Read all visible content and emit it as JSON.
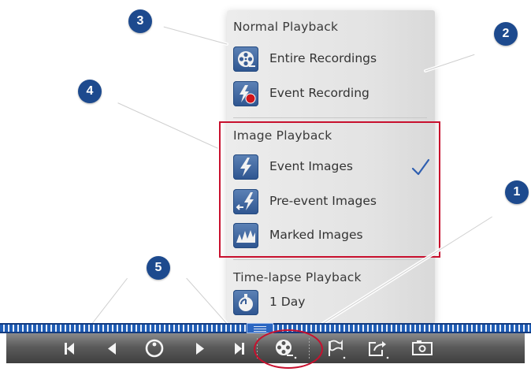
{
  "menu": {
    "normal_title": "Normal Playback",
    "normal_items": [
      {
        "label": "Entire Recordings",
        "icon": "film-reel-icon"
      },
      {
        "label": "Event Recording",
        "icon": "event-recording-icon"
      }
    ],
    "image_title": "Image Playback",
    "image_items": [
      {
        "label": "Event Images",
        "icon": "lightning-icon",
        "checked": true
      },
      {
        "label": "Pre-event Images",
        "icon": "pre-event-icon"
      },
      {
        "label": "Marked Images",
        "icon": "marked-images-icon"
      }
    ],
    "timelapse_title": "Time-lapse Playback",
    "timelapse_items": [
      {
        "label": "1 Day",
        "icon": "stopwatch-icon"
      }
    ]
  },
  "callouts": [
    "1",
    "2",
    "3",
    "4",
    "5"
  ],
  "toolbar": {
    "buttons": [
      "skip-to-start-icon",
      "previous-icon",
      "live-icon",
      "next-icon",
      "skip-to-end-icon",
      "playback-mode-icon",
      "flag-icon",
      "export-icon",
      "snapshot-icon"
    ]
  },
  "colors": {
    "accent": "#1d4a8e",
    "highlight": "#c8102e",
    "icon_bg": "#3f66a0",
    "check": "#2f5fb0"
  }
}
